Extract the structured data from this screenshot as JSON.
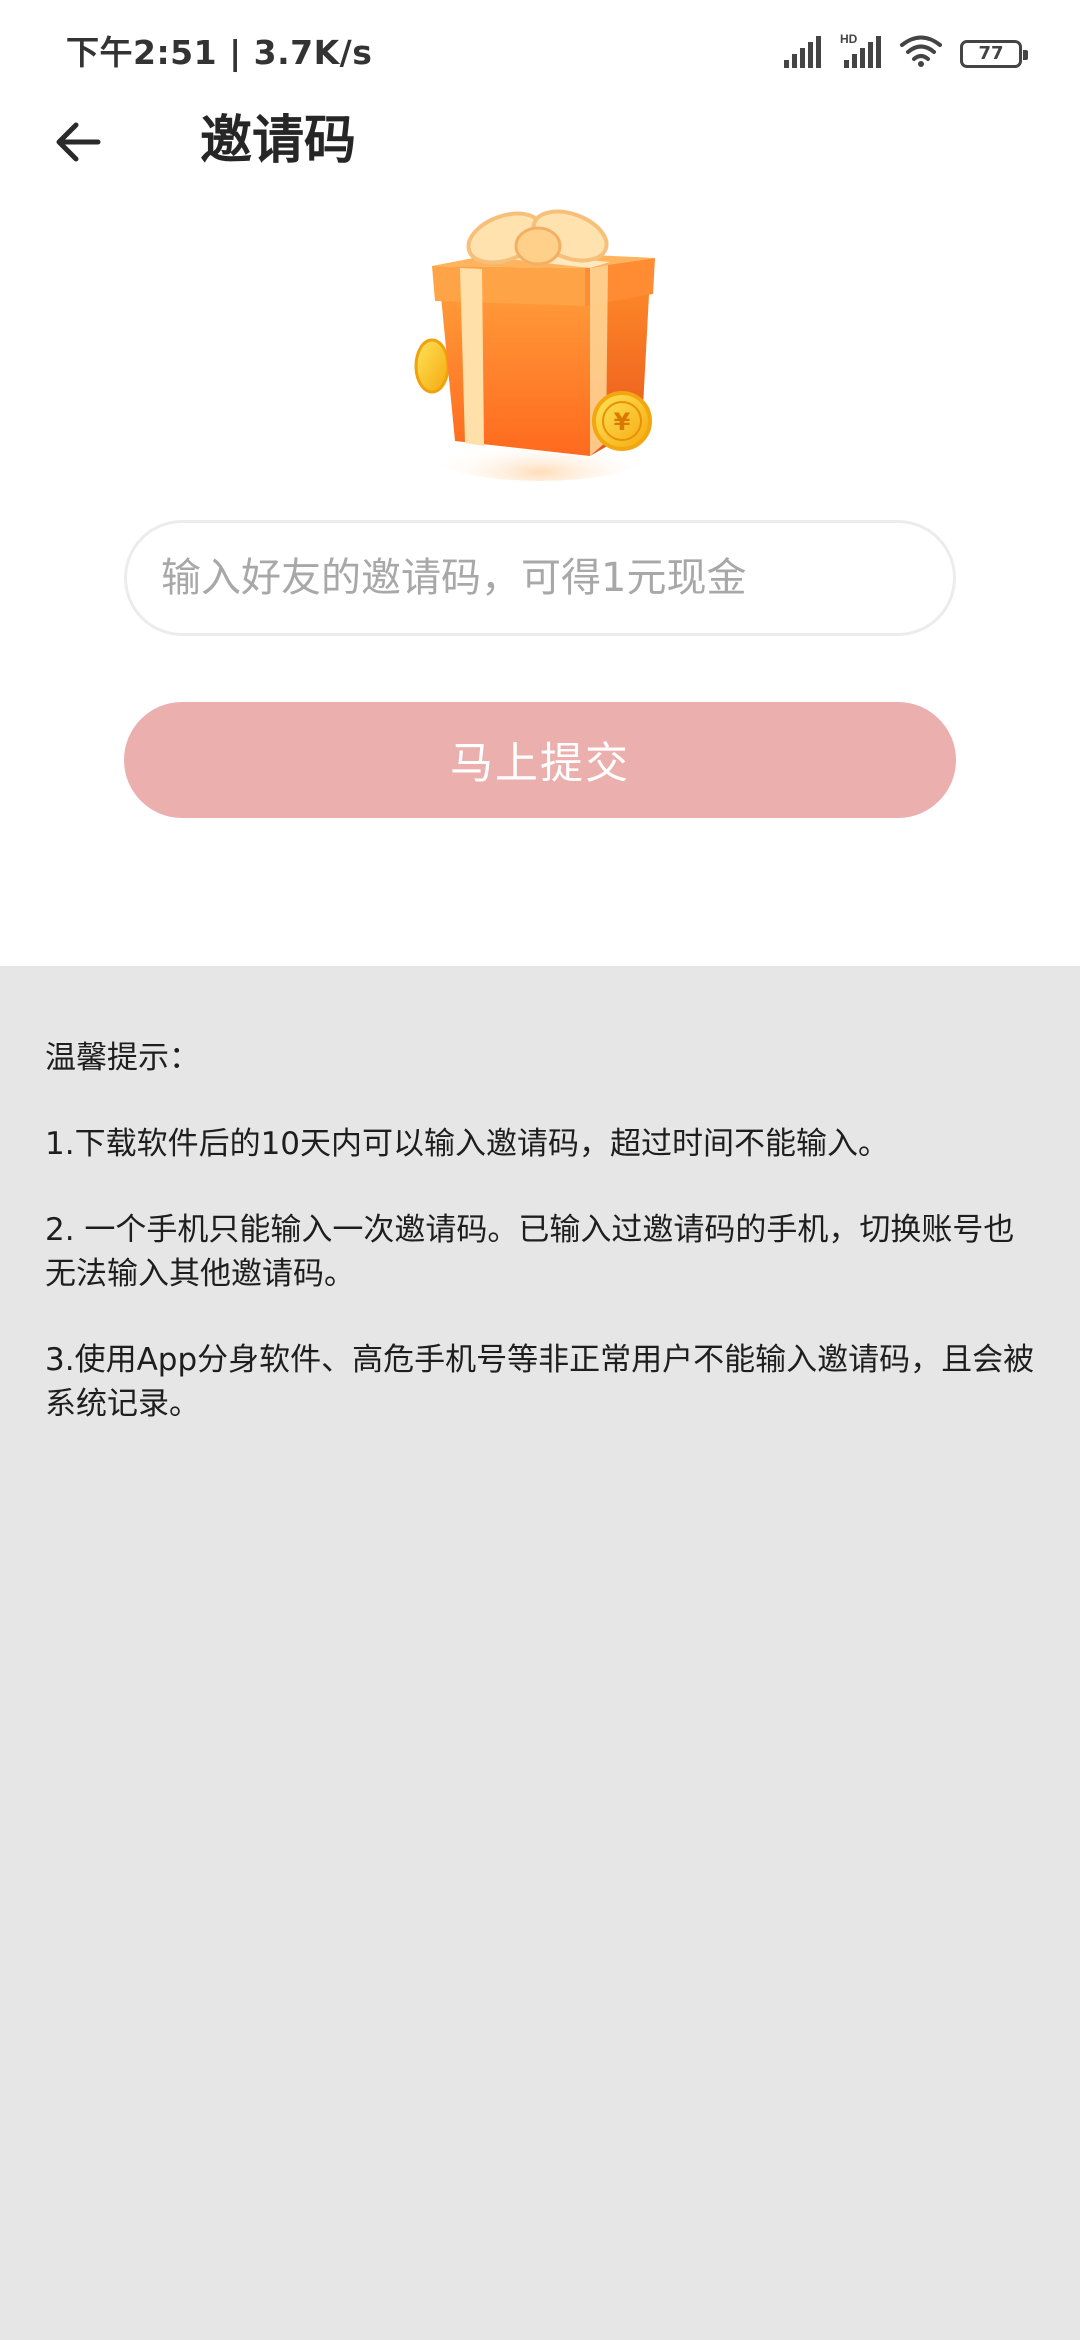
{
  "status_bar": {
    "time": "下午2:51 | 3.7K/s",
    "battery": "77",
    "icons": [
      "signal-icon",
      "hd-signal-icon",
      "wifi-icon",
      "battery-icon"
    ]
  },
  "header": {
    "back_icon": "back-arrow-icon",
    "title": "邀请码"
  },
  "gift": {
    "icon": "gift-box-icon",
    "coin_symbol": "¥"
  },
  "invite_form": {
    "placeholder": "输入好友的邀请码，可得1元现金",
    "value": "",
    "submit_label": "马上提交"
  },
  "tips": {
    "heading": "温馨提示：",
    "items": [
      "1.下载软件后的10天内可以输入邀请码，超过时间不能输入。",
      "2. 一个手机只能输入一次邀请码。已输入过邀请码的手机，切换账号也无法输入其他邀请码。",
      "3.使用App分身软件、高危手机号等非正常用户不能输入邀请码，且会被系统记录。"
    ]
  },
  "colors": {
    "submit_button": "#ebb0ad",
    "tips_background": "#e6e6e6",
    "gift_orange": "#ff8a2a"
  }
}
